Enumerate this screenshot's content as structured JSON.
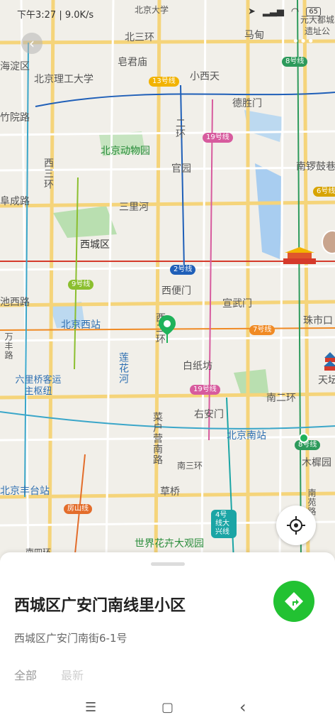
{
  "status": {
    "time_speed": "下午3:27 | 9.0K/s",
    "battery": "65"
  },
  "map": {
    "labels": [
      "北京大学",
      "元大都城",
      "遗址公",
      "北三环",
      "马甸",
      "海淀区",
      "皂君庙",
      "北京理工大学",
      "小西天",
      "德胜门",
      "竹院路",
      "北京动物园",
      "官园",
      "南锣鼓巷",
      "三里河",
      "阜成路",
      "西城区",
      "西便门",
      "宣武门",
      "池西路",
      "北京西站",
      "珠市口",
      "万丰路",
      "六里桥客运主枢纽",
      "白纸坊",
      "天坛",
      "右安门",
      "北京南站",
      "木樨园",
      "南二环",
      "北京丰台站",
      "草桥",
      "世界花卉大观园",
      "南三环",
      "南四环"
    ],
    "vertical_labels": [
      "西三环",
      "二环",
      "西二环",
      "莲花河",
      "菜户营南路",
      "南苑路"
    ],
    "line_badges": [
      {
        "text": "13号线",
        "color": "#f2b300"
      },
      {
        "text": "19号线",
        "color": "#d75b9e"
      },
      {
        "text": "8号线",
        "color": "#2d9a5b"
      },
      {
        "text": "6号线",
        "color": "#d8a400"
      },
      {
        "text": "2号线",
        "color": "#1f5fb8"
      },
      {
        "text": "9号线",
        "color": "#8bbf2f"
      },
      {
        "text": "7号线",
        "color": "#f08a24"
      },
      {
        "text": "19号线",
        "color": "#d75b9e"
      },
      {
        "text": "8号线",
        "color": "#2d9a5b"
      },
      {
        "text": "房山线",
        "color": "#e36d2b"
      },
      {
        "text": "4号线大兴线",
        "color": "#1ba5a5"
      }
    ]
  },
  "sheet": {
    "title": "西城区广安门南线里小区",
    "address": "西城区广安门南街6-1号",
    "tab_all": "全部",
    "tab_recent": "最新"
  },
  "nav": {
    "recents": "☰",
    "home": "▢",
    "back": "‹"
  }
}
